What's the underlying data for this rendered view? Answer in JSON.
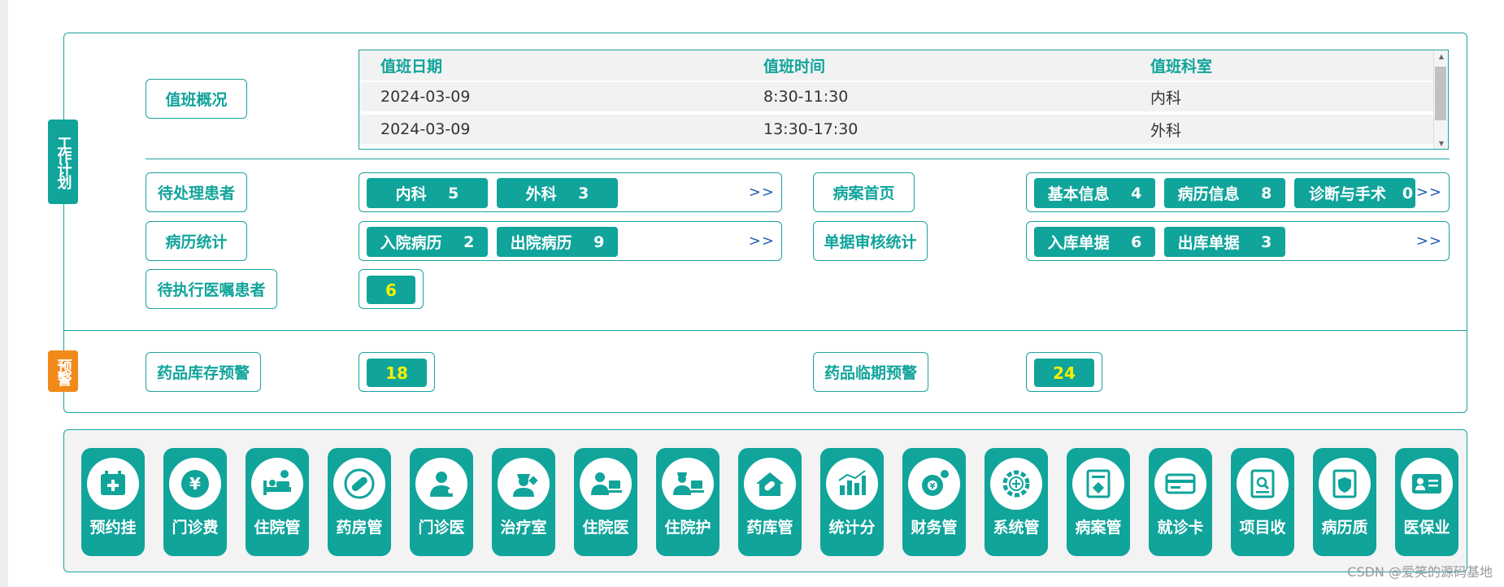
{
  "tags": {
    "plan": "工作计划",
    "warning": "预警"
  },
  "duty": {
    "label": "值班概况",
    "headers": [
      "值班日期",
      "值班时间",
      "值班科室"
    ],
    "rows": [
      [
        "2024-03-09",
        "8:30-11:30",
        "内科"
      ],
      [
        "2024-03-09",
        "13:30-17:30",
        "外科"
      ]
    ]
  },
  "pending": {
    "label": "待处理患者",
    "chips": [
      {
        "name": "内科",
        "count": "5"
      },
      {
        "name": "外科",
        "count": "3"
      }
    ],
    "more": ">>"
  },
  "case_home": {
    "label": "病案首页",
    "chips": [
      {
        "name": "基本信息",
        "count": "4"
      },
      {
        "name": "病历信息",
        "count": "8"
      },
      {
        "name": "诊断与手术",
        "count": "0"
      }
    ],
    "more": ">>"
  },
  "record_stats": {
    "label": "病历统计",
    "chips": [
      {
        "name": "入院病历",
        "count": "2"
      },
      {
        "name": "出院病历",
        "count": "9"
      }
    ],
    "more": ">>"
  },
  "voucher_review": {
    "label": "单据审核统计",
    "chips": [
      {
        "name": "入库单据",
        "count": "6"
      },
      {
        "name": "出库单据",
        "count": "3"
      }
    ],
    "more": ">>"
  },
  "orders": {
    "label": "待执行医嘱患者",
    "value": "6"
  },
  "stock_warning": {
    "label": "药品库存预警",
    "value": "18"
  },
  "expiry_warning": {
    "label": "药品临期预警",
    "value": "24"
  },
  "apps": [
    {
      "label": "预约挂",
      "icon": "calendar-plus-icon"
    },
    {
      "label": "门诊费",
      "icon": "yen-coin-icon"
    },
    {
      "label": "住院管",
      "icon": "hospital-bed-icon"
    },
    {
      "label": "药房管",
      "icon": "pill-icon"
    },
    {
      "label": "门诊医",
      "icon": "doctor-icon"
    },
    {
      "label": "治疗室",
      "icon": "nurse-icon"
    },
    {
      "label": "住院医",
      "icon": "doctor-desk-icon"
    },
    {
      "label": "住院护",
      "icon": "nurse-desk-icon"
    },
    {
      "label": "药库管",
      "icon": "pharmacy-house-icon"
    },
    {
      "label": "统计分",
      "icon": "bar-chart-icon"
    },
    {
      "label": "财务管",
      "icon": "finance-gear-icon"
    },
    {
      "label": "系统管",
      "icon": "system-gear-icon"
    },
    {
      "label": "病案管",
      "icon": "case-file-icon"
    },
    {
      "label": "就诊卡",
      "icon": "card-icon"
    },
    {
      "label": "项目收",
      "icon": "search-document-icon"
    },
    {
      "label": "病历质",
      "icon": "shield-document-icon"
    },
    {
      "label": "医保业",
      "icon": "id-card-icon"
    }
  ],
  "watermark": "CSDN @爱笑的源码基地"
}
